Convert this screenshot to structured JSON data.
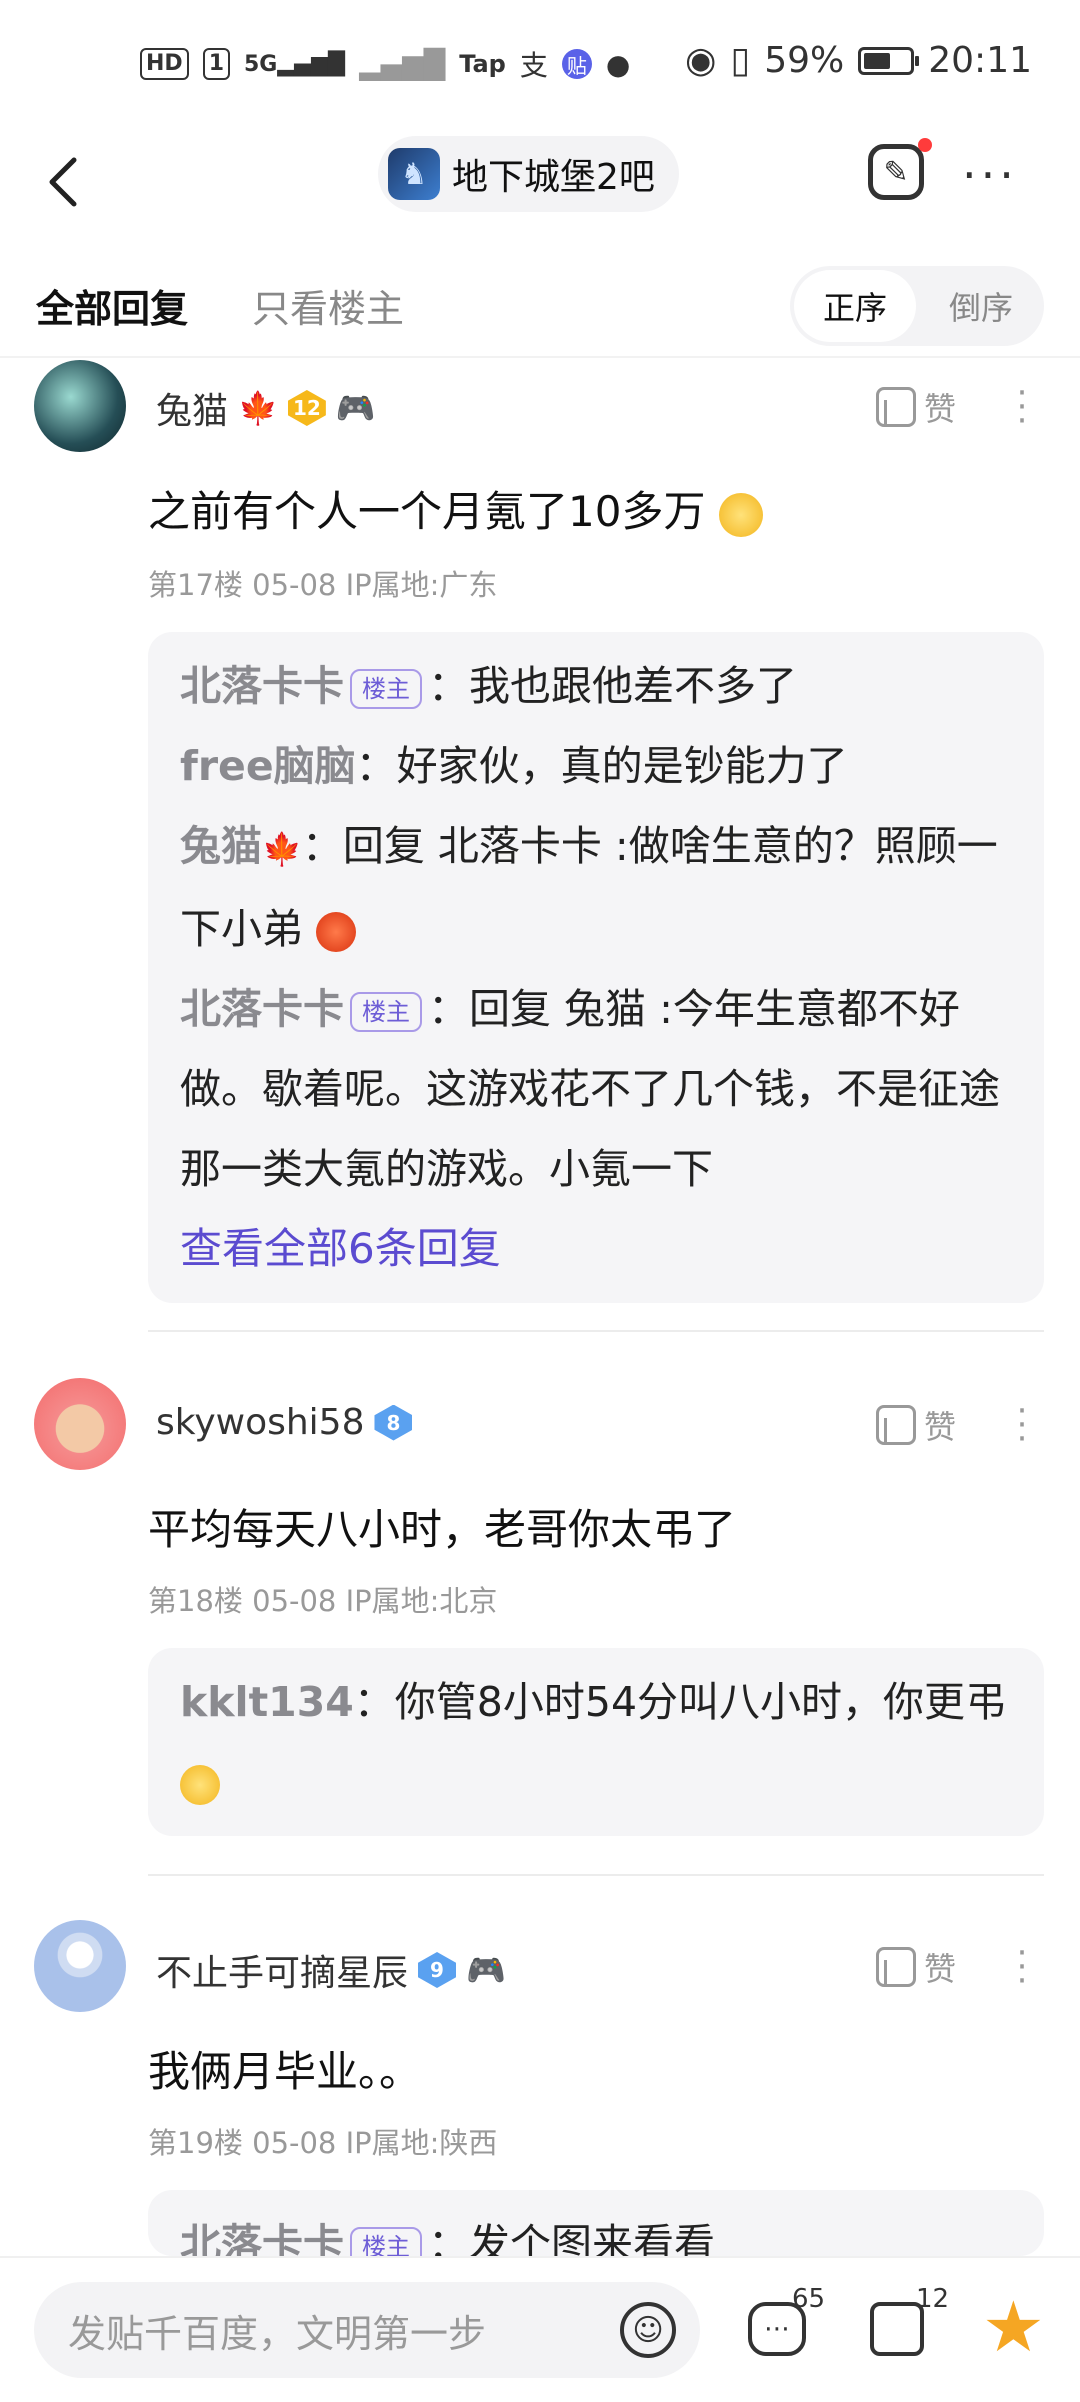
{
  "status_bar": {
    "left_items": [
      "HD",
      "1",
      "5G",
      "Tap",
      "支",
      "贴"
    ],
    "battery_percent": "59%",
    "battery_level": 0.59,
    "time": "20:11"
  },
  "nav": {
    "back_icon": "chevron-left-icon",
    "forum_name": "地下城堡2吧",
    "more_label": "···"
  },
  "filters": {
    "all_replies": "全部回复",
    "op_only": "只看楼主",
    "order_asc": "正序",
    "order_desc": "倒序"
  },
  "posts": [
    {
      "username": "兔猫",
      "level": "12",
      "text": "之前有个人一个月氪了10多万",
      "meta": "第17楼  05-08  IP属地:广东",
      "like_label": "赞",
      "replies": [
        {
          "name": "北落卡卡",
          "is_op": true,
          "sep": "：",
          "text": "我也跟他差不多了"
        },
        {
          "name": "free脑脑",
          "is_op": false,
          "sep": "：",
          "text": "好家伙，真的是钞能力了"
        },
        {
          "name": "兔猫",
          "is_op": false,
          "sep": "：",
          "text": "回复 北落卡卡 :做啥生意的？照顾一下小弟"
        },
        {
          "name": "北落卡卡",
          "is_op": true,
          "sep": "：",
          "text": "回复 兔猫 :今年生意都不好做。歇着呢。这游戏花不了几个钱，不是征途那一类大氪的游戏。小氪一下"
        }
      ],
      "view_all": "查看全部6条回复"
    },
    {
      "username": "skywoshi58",
      "level": "8",
      "text": "平均每天八小时，老哥你太弔了",
      "meta": "第18楼  05-08  IP属地:北京",
      "like_label": "赞",
      "replies": [
        {
          "name": "kklt134",
          "is_op": false,
          "sep": "：",
          "text": "你管8小时54分叫八小时，你更弔"
        }
      ]
    },
    {
      "username": "不止手可摘星辰",
      "level": "9",
      "text": "我俩月毕业。。",
      "meta": "第19楼  05-08  IP属地:陕西",
      "like_label": "赞",
      "replies": [
        {
          "name": "北落卡卡",
          "is_op": true,
          "sep": "：",
          "text": "发个图来看看"
        }
      ]
    }
  ],
  "op_tag": "楼主",
  "bottom_bar": {
    "placeholder": "发贴千百度，文明第一步",
    "comment_count": "65",
    "like_count": "12"
  },
  "colors": {
    "accent_purple": "#5b4bd0",
    "star": "#f5a623",
    "notification_dot": "#ff3b3b"
  }
}
